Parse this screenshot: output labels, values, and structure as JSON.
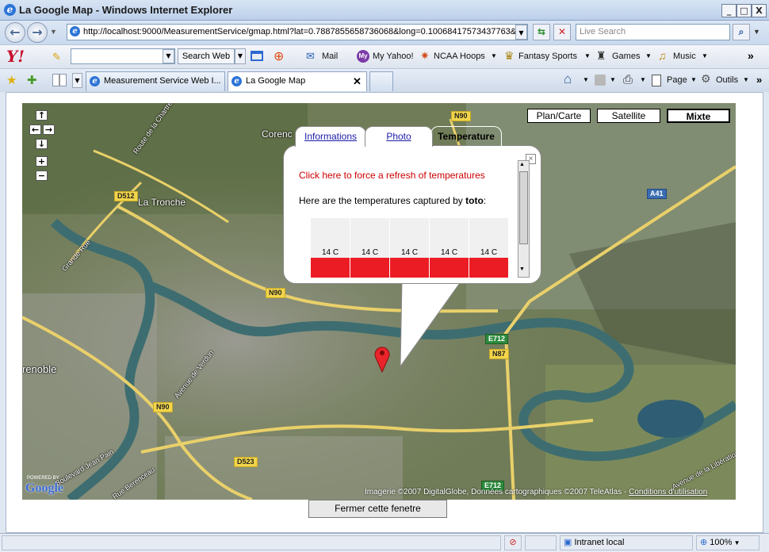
{
  "window": {
    "title": "La Google Map - Windows Internet Explorer",
    "controls": [
      "_",
      "□",
      "X"
    ]
  },
  "address": {
    "url": "http://localhost:9000/MeasurementService/gmap.html?lat=0.7887855658736068&long=0.10068417573437763&",
    "search_placeholder": "Live Search"
  },
  "yahoo": {
    "logo": "Y!",
    "search_button": "Search Web",
    "items": [
      "Mail",
      "My Yahoo!",
      "NCAA Hoops",
      "Fantasy Sports",
      "Games",
      "Music"
    ],
    "more": "»"
  },
  "tabs": [
    {
      "label": "Measurement Service Web I..."
    },
    {
      "label": "La Google Map"
    }
  ],
  "commands": {
    "page": "Page",
    "tools": "Outils"
  },
  "map": {
    "type_buttons": [
      "Plan/Carte",
      "Satellite",
      "Mixte"
    ],
    "zoom": {
      "up": "↑",
      "left": "←",
      "right": "→",
      "down": "↓",
      "in": "+",
      "out": "−"
    },
    "places": {
      "corenc": "Corenc",
      "tronche": "La Tronche",
      "grenoble": "renoble"
    },
    "roads": {
      "n90a": "N90",
      "n90b": "N90",
      "n90c": "N90",
      "d512": "D512",
      "a41": "A41",
      "e712a": "E712",
      "n87": "N87",
      "d523": "D523",
      "e712b": "E712",
      "chartreuse": "Route de la Chartreuse",
      "grandrue": "Grande Rue",
      "verdun": "Avenue de Verdun",
      "jeanpain": "Boulevard Jean Pain",
      "liberation": "Avenue de la Libération",
      "berenceau": "Rue Berenceau"
    },
    "attribution": "Imagerie ©2007 DigitalGlobe, Données cartographiques ©2007 TeleAtlas - ",
    "terms": "Conditions d'utilisation",
    "powered": "POWERED BY",
    "google": "Google"
  },
  "infowindow": {
    "tabs": [
      "Informations",
      "Photo",
      "Temperature"
    ],
    "refresh_link": "Click here to force a refresh of temperatures",
    "captured_prefix": "Here are the temperatures captured by ",
    "user": "toto",
    "suffix": ":",
    "temperatures": [
      "14 C",
      "14 C",
      "14 C",
      "14 C",
      "14 C"
    ],
    "close": "×"
  },
  "close_button": "Fermer cette fenetre",
  "statusbar": {
    "zone": "Intranet local",
    "zoom": "100%"
  },
  "colors": {
    "bar": "#ec1c24",
    "link_red": "#cc0000",
    "link_blue": "#1a1aa6"
  }
}
